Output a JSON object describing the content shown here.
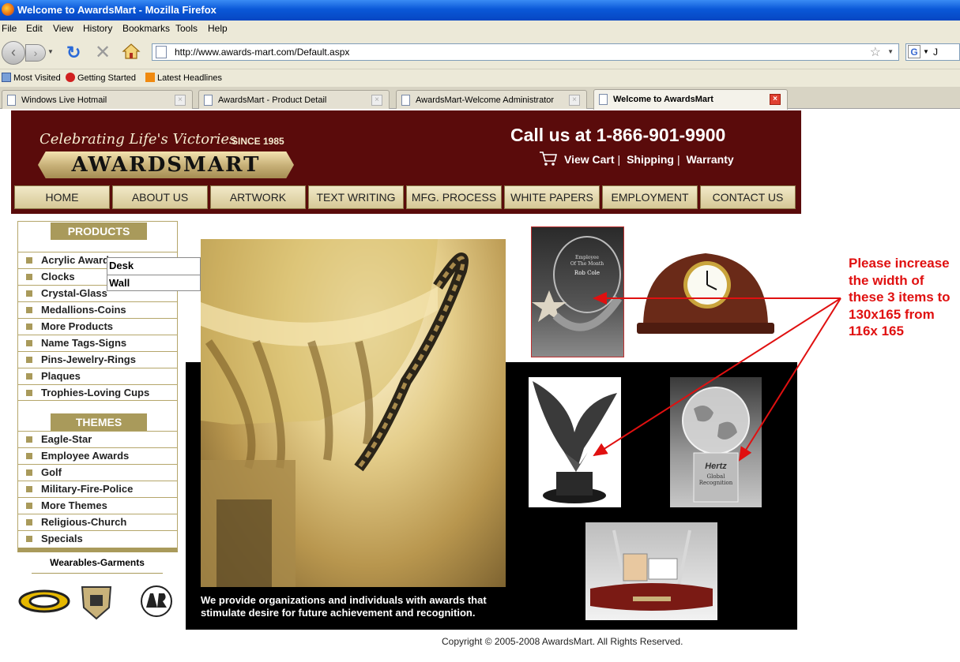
{
  "window": {
    "title": "Welcome to AwardsMart - Mozilla Firefox"
  },
  "menu": [
    "File",
    "Edit",
    "View",
    "History",
    "Bookmarks",
    "Tools",
    "Help"
  ],
  "address_bar": {
    "url": "http://www.awards-mart.com/Default.aspx"
  },
  "search_box": {
    "value": "J"
  },
  "bookmarks": [
    "Most Visited",
    "Getting Started",
    "Latest Headlines"
  ],
  "tabs": [
    {
      "label": "Windows Live Hotmail",
      "active": false
    },
    {
      "label": "AwardsMart - Product Detail",
      "active": false
    },
    {
      "label": "AwardsMart-Welcome Administrator",
      "active": false
    },
    {
      "label": "Welcome to AwardsMart",
      "active": true
    }
  ],
  "site": {
    "tagline": "Celebrating Life's Victories",
    "since": "SINCE 1985",
    "logo": "AWARDSMART",
    "phone": "Call us at 1-866-901-9900",
    "top_links": [
      "View Cart",
      "Shipping",
      "Warranty"
    ],
    "nav": [
      "HOME",
      "ABOUT US",
      "ARTWORK",
      "TEXT WRITING",
      "MFG. PROCESS",
      "WHITE PAPERS",
      "EMPLOYMENT",
      "CONTACT US"
    ]
  },
  "sidebar": {
    "products_title": "PRODUCTS",
    "products": [
      "Acrylic Awards",
      "Clocks",
      "Crystal-Glass",
      "Medallions-Coins",
      "More Products",
      "Name Tags-Signs",
      "Pins-Jewelry-Rings",
      "Plaques",
      "Trophies-Loving Cups"
    ],
    "flyout": [
      "Desk",
      "Wall"
    ],
    "themes_title": "THEMES",
    "themes": [
      "Eagle-Star",
      "Employee Awards",
      "Golf",
      "Military-Fire-Police",
      "More Themes",
      "Religious-Church",
      "Specials"
    ],
    "wearables": "Wearables-Garments"
  },
  "main": {
    "copy": "We provide organizations and individuals with awards that stimulate desire for future achievement and recognition.",
    "acrylic_text": [
      "Employee",
      "Of The Month",
      "Rob Cole"
    ],
    "globe_text": [
      "Hertz",
      "Global",
      "Recognition"
    ]
  },
  "annotation": {
    "note": "Please increase the width of these 3 items to 130x165 from 116x 165",
    "color": "#e01010"
  },
  "footer": {
    "copyright": "Copyright © 2005-2008 AwardsMart. All Rights Reserved."
  },
  "colors": {
    "header_bg": "#5a0b0b",
    "accent": "#a99a5b"
  }
}
